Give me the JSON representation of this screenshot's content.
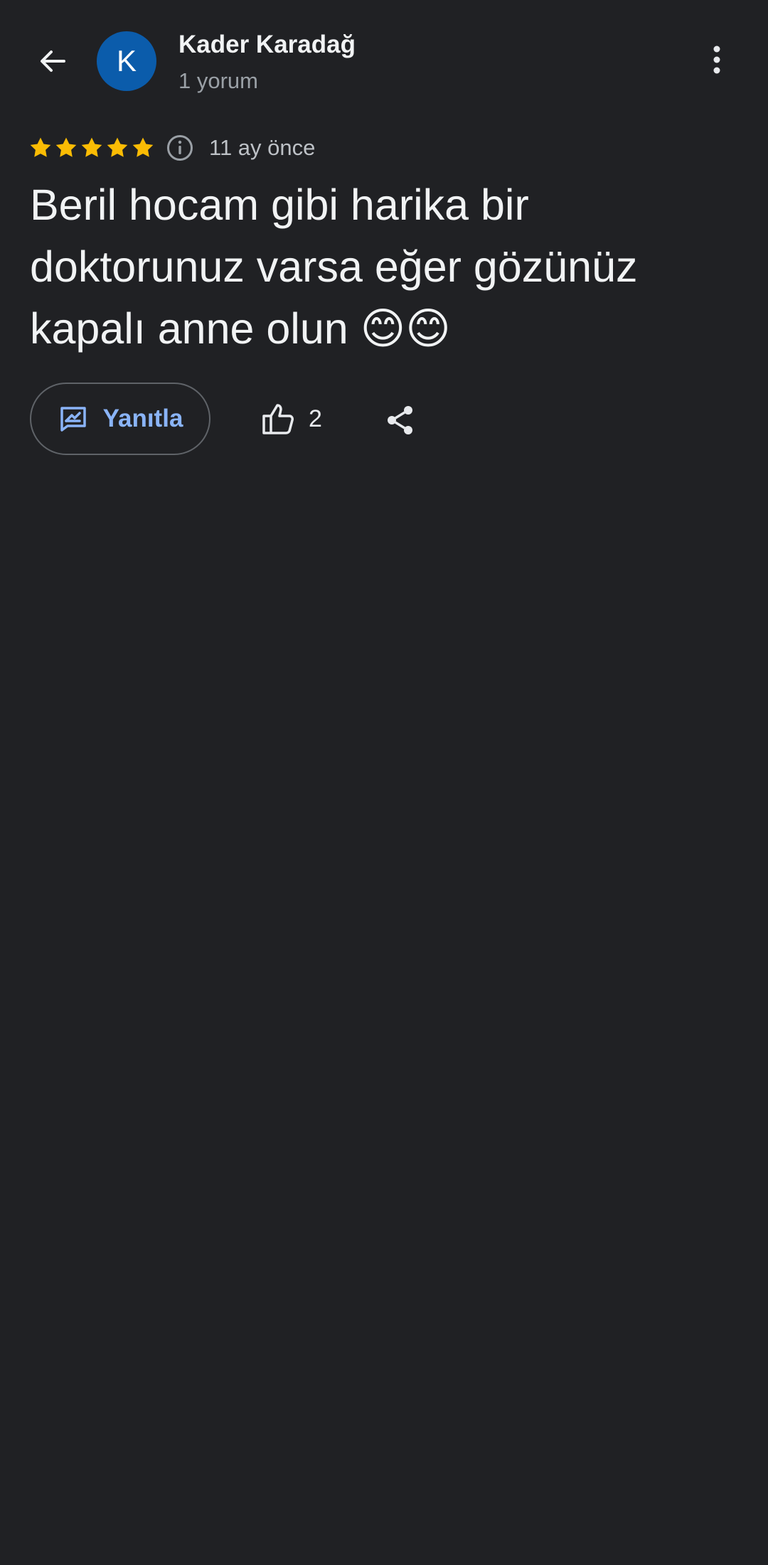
{
  "header": {
    "back_icon": "arrow-left-icon",
    "avatar_initial": "K",
    "avatar_color": "#0b5cab",
    "reviewer_name": "Kader Karadağ",
    "review_count": "1 yorum",
    "more_icon": "more-vertical-icon"
  },
  "review": {
    "rating": 5,
    "rating_max": 5,
    "star_color": "#fbbc04",
    "info_icon": "info-icon",
    "age": "11 ay önce",
    "text": "Beril hocam gibi harika bir doktorunuz varsa eğer gözünüz kapalı anne olun 😊😊"
  },
  "actions": {
    "reply_label": "Yanıtla",
    "reply_icon": "reply-message-icon",
    "like_icon": "thumbs-up-icon",
    "like_count": "2",
    "share_icon": "share-icon"
  },
  "theme": {
    "background": "#202124",
    "primary_text": "#f1f3f4",
    "secondary_text": "#9aa0a6",
    "accent": "#8ab4f8"
  }
}
